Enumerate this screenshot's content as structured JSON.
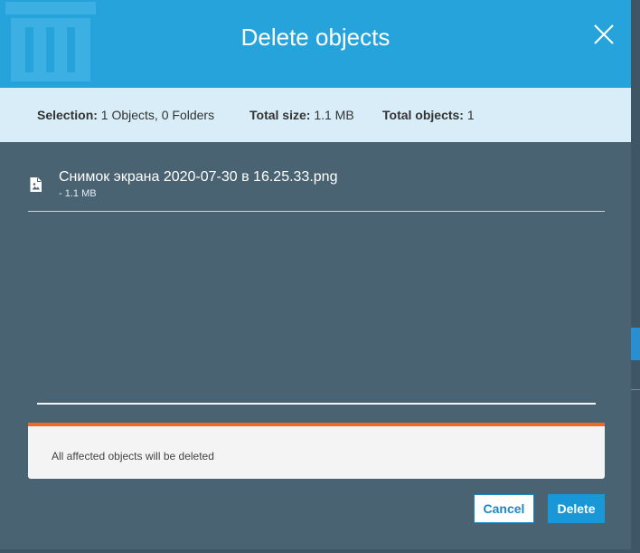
{
  "dialog": {
    "title": "Delete objects",
    "close_icon": "close-icon"
  },
  "summary": {
    "selection_label": "Selection:",
    "selection_value": "1 Objects, 0 Folders",
    "total_size_label": "Total size:",
    "total_size_value": "1.1 MB",
    "total_objects_label": "Total objects:",
    "total_objects_value": "1"
  },
  "files": [
    {
      "name": "Снимок экрана 2020-07-30 в 16.25.33.png",
      "size": "- 1.1 MB",
      "icon": "image-file-icon"
    }
  ],
  "warning": {
    "text": "All affected objects will be deleted"
  },
  "buttons": {
    "cancel": "Cancel",
    "delete": "Delete"
  },
  "colors": {
    "header": "#27a3dc",
    "summary_bg": "#d8edf8",
    "body_bg": "#496373",
    "warning_accent": "#ee6a1e",
    "primary": "#1997d6"
  }
}
